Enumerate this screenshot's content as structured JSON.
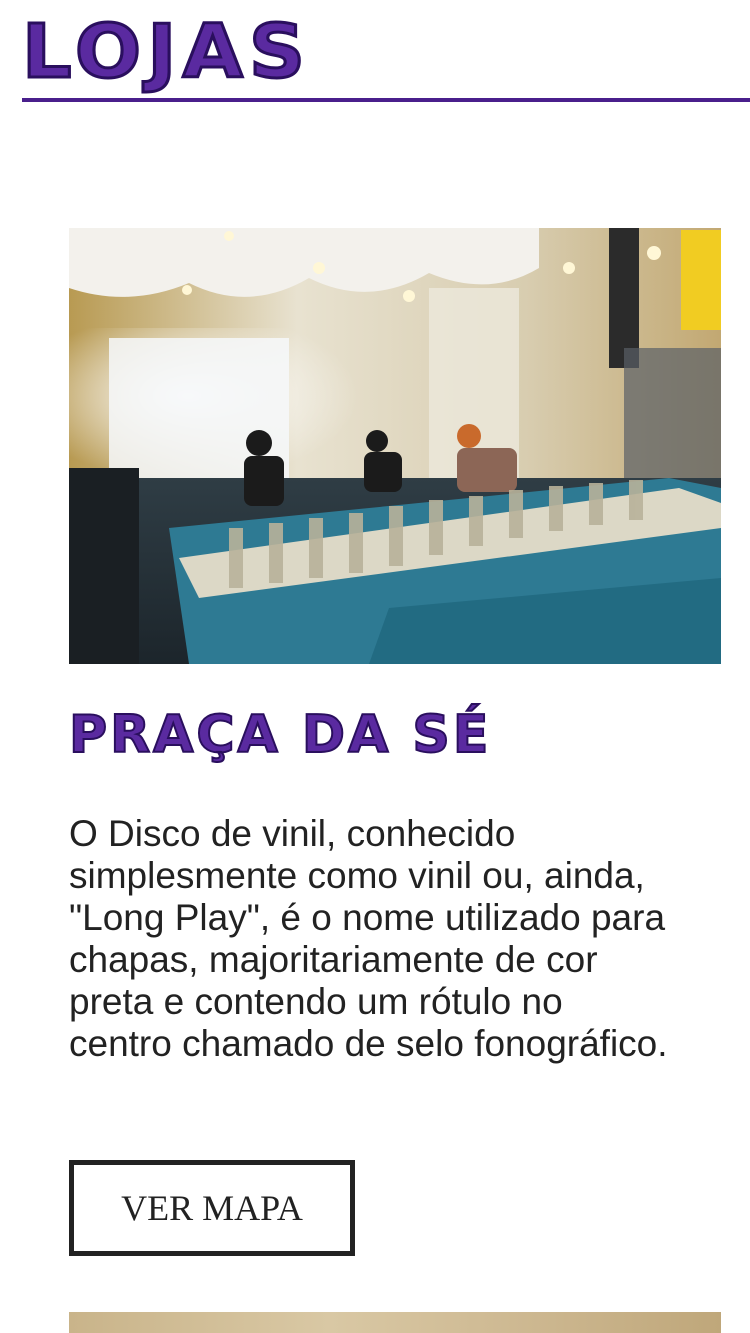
{
  "header": {
    "title": "LOJAS"
  },
  "stores": [
    {
      "name": "PRAÇA DA SÉ",
      "description": "O Disco de vinil, conhecido simplesmente como vinil ou, ainda, \"Long Play\", é o nome utilizado para chapas, majoritariamente de cor preta e contendo um rótulo no centro chamado de selo fonográfico.",
      "button_label": "VER MAPA",
      "photo": "record-store-interior"
    }
  ],
  "colors": {
    "accent": "#5a2aa0",
    "accent_dark": "#2a0f5e",
    "text": "#222222",
    "background": "#ffffff"
  }
}
